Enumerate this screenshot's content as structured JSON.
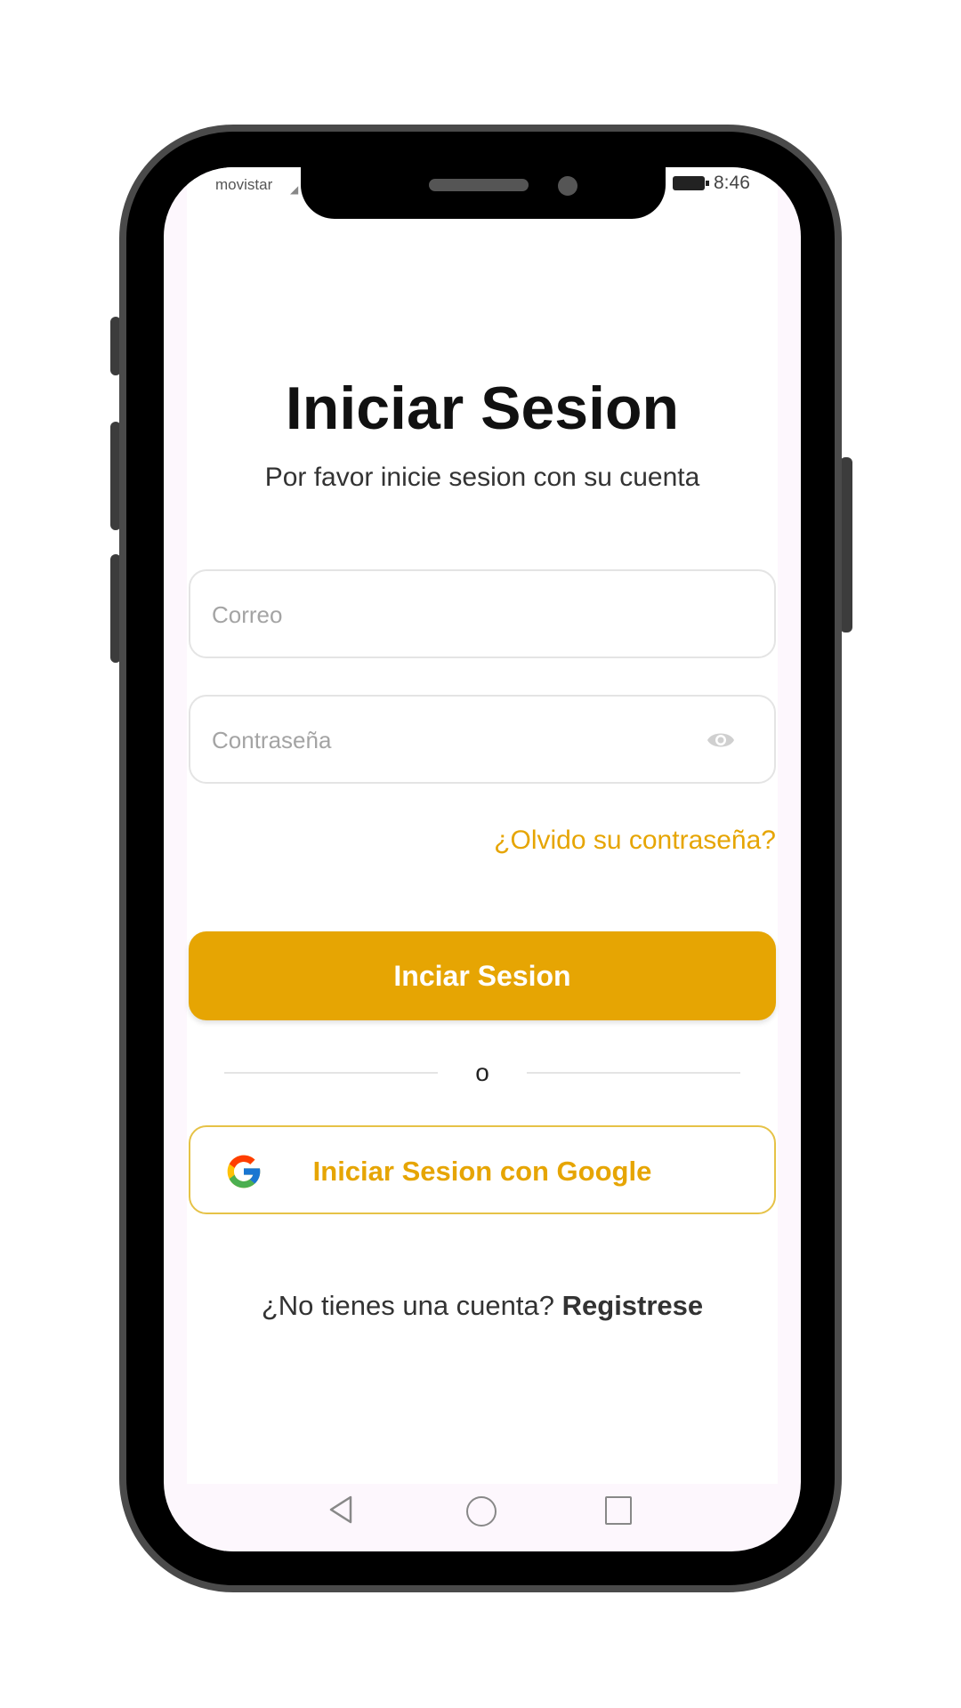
{
  "status_bar": {
    "carrier": "movistar",
    "time": "8:46"
  },
  "login": {
    "title": "Iniciar Sesion",
    "subtitle": "Por favor inicie sesion con su cuenta",
    "email_placeholder": "Correo",
    "email_value": "",
    "password_placeholder": "Contraseña",
    "password_value": "",
    "forgot_link": "¿Olvido su contraseña?",
    "login_button": "Inciar Sesion",
    "divider_text": "o",
    "google_button": "Iniciar Sesion con Google",
    "register_prompt": "¿No tienes una cuenta?",
    "register_link": "Registrese"
  },
  "colors": {
    "accent": "#e6a503",
    "google_border": "#e6c247",
    "frame": "#000000"
  },
  "icons": [
    "eye-icon",
    "google-icon",
    "nav-back-icon",
    "nav-home-icon",
    "nav-recent-icon"
  ]
}
